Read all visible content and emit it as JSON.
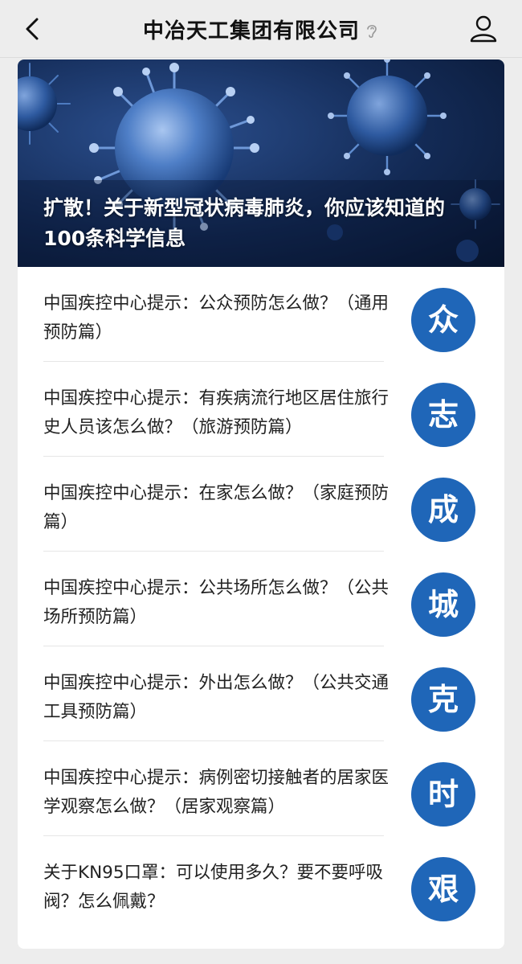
{
  "header": {
    "title": "中冶天工集团有限公司",
    "back_icon": "chevron-left-icon",
    "ear_icon": "ear-icon",
    "profile_icon": "user-icon"
  },
  "banner": {
    "title": "扩散！关于新型冠状病毒肺炎，你应该知道的100条科学信息"
  },
  "articles": [
    {
      "title": "中国疾控中心提示：公众预防怎么做？（通用预防篇）",
      "badge": "众"
    },
    {
      "title": "中国疾控中心提示：有疾病流行地区居住旅行史人员该怎么做？（旅游预防篇）",
      "badge": "志"
    },
    {
      "title": "中国疾控中心提示：在家怎么做？（家庭预防篇）",
      "badge": "成"
    },
    {
      "title": "中国疾控中心提示：公共场所怎么做？（公共场所预防篇）",
      "badge": "城"
    },
    {
      "title": "中国疾控中心提示：外出怎么做？（公共交通工具预防篇）",
      "badge": "克"
    },
    {
      "title": "中国疾控中心提示：病例密切接触者的居家医学观察怎么做？（居家观察篇）",
      "badge": "时"
    },
    {
      "title": "关于KN95口罩：可以使用多久？要不要呼吸阀？怎么佩戴？",
      "badge": "艰"
    }
  ],
  "colors": {
    "badge": "#1f66b8",
    "background": "#ededed",
    "banner": "#132a55"
  }
}
